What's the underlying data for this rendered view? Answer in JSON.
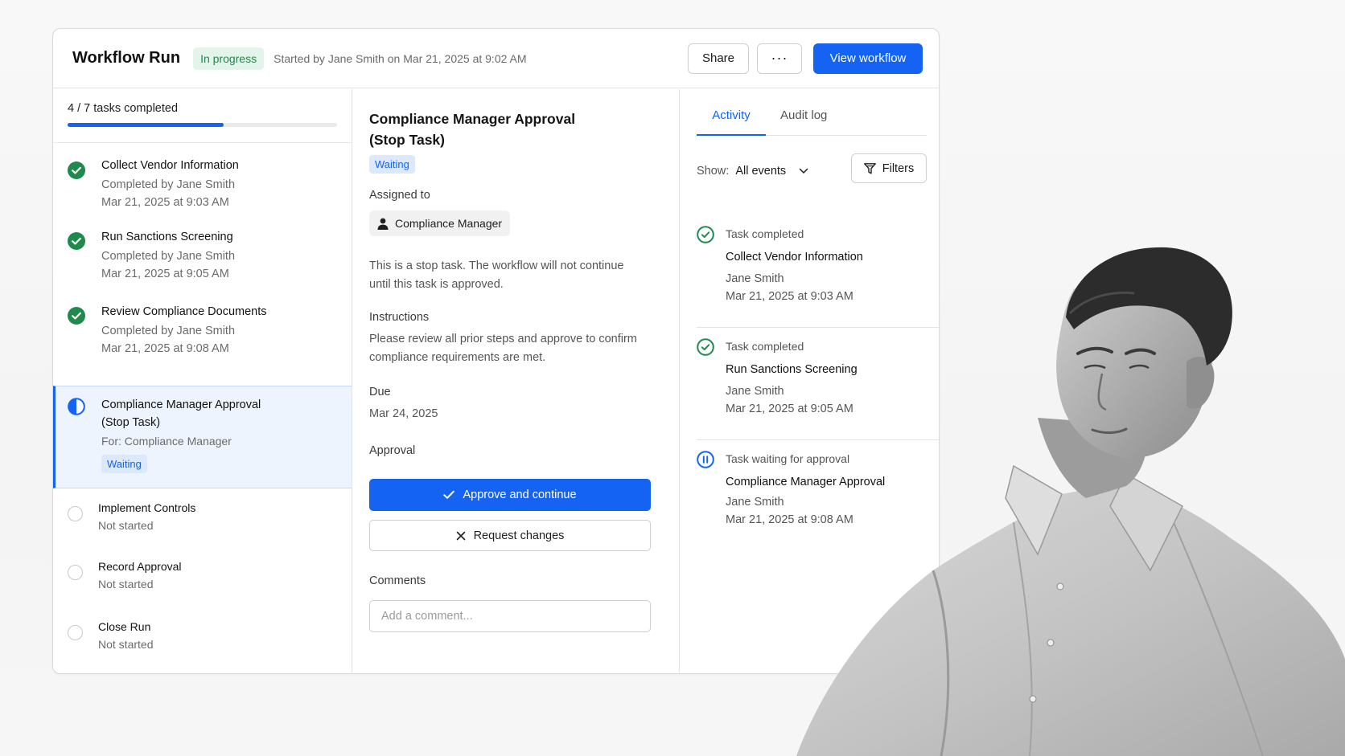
{
  "header": {
    "title": "Workflow Run",
    "status": "In progress",
    "started": "Started by Jane Smith on Mar 21, 2025 at 9:02 AM",
    "share_label": "Share",
    "more_label": "···",
    "view_label": "View workflow"
  },
  "progress": {
    "text": "4 / 7 tasks completed",
    "fraction": 0.58
  },
  "tasks": [
    {
      "name": "Collect Vendor Information",
      "line1": "Completed by Jane Smith",
      "line2": "Mar 21, 2025 at 9:03 AM",
      "state": "done"
    },
    {
      "name": "Run Sanctions Screening",
      "line1": "Completed by Jane Smith",
      "line2": "Mar 21, 2025 at 9:05 AM",
      "state": "done"
    },
    {
      "name": "Review Compliance Documents",
      "line1": "Completed by Jane Smith",
      "line2": "Mar 21, 2025 at 9:08 AM",
      "state": "done"
    },
    {
      "name": "Compliance Manager Approval",
      "name2": "(Stop Task)",
      "line1": "For: Compliance Manager",
      "badge": "Waiting",
      "state": "waiting"
    },
    {
      "name": "Implement Controls",
      "line1": "Not started",
      "state": "not-started"
    },
    {
      "name": "Record Approval",
      "line1": "Not started",
      "state": "not-started"
    },
    {
      "name": "Close Run",
      "line1": "Not started",
      "state": "not-started"
    }
  ],
  "detail": {
    "title_line1": "Compliance Manager Approval",
    "title_line2": "(Stop Task)",
    "badge": "Waiting",
    "assigned_label": "Assigned to",
    "assignee": "Compliance Manager",
    "stop_line1": "This is a stop task. The workflow will not continue",
    "stop_line2": "until this task is approved.",
    "instructions_label": "Instructions",
    "instructions_line1": "Please review all prior steps and approve to confirm",
    "instructions_line2": "compliance requirements are met.",
    "due_label": "Due",
    "due_value": "Mar 24, 2025",
    "approval_label": "Approval",
    "approve_btn": "Approve and continue",
    "request_btn": "Request changes",
    "comments_label": "Comments",
    "comment_placeholder": "Add a comment..."
  },
  "activity": {
    "tab_active": "Activity",
    "tab_other": "Audit log",
    "show_label": "Show:",
    "show_value": "All events",
    "filters_label": "Filters",
    "events": [
      {
        "type": "Task completed",
        "task": "Collect Vendor Information",
        "user": "Jane Smith",
        "time": "Mar 21, 2025 at 9:03 AM",
        "state": "done"
      },
      {
        "type": "Task completed",
        "task": "Run Sanctions Screening",
        "user": "Jane Smith",
        "time": "Mar 21, 2025 at 9:05 AM",
        "state": "done"
      },
      {
        "type": "Task waiting for approval",
        "task": "Compliance Manager Approval",
        "user": "Jane Smith",
        "time": "Mar 21, 2025 at 9:08 AM",
        "state": "waiting"
      }
    ]
  },
  "colors": {
    "accent": "#1463f3",
    "success": "#1f8a4c",
    "waiting_bg": "#dce9fd"
  }
}
